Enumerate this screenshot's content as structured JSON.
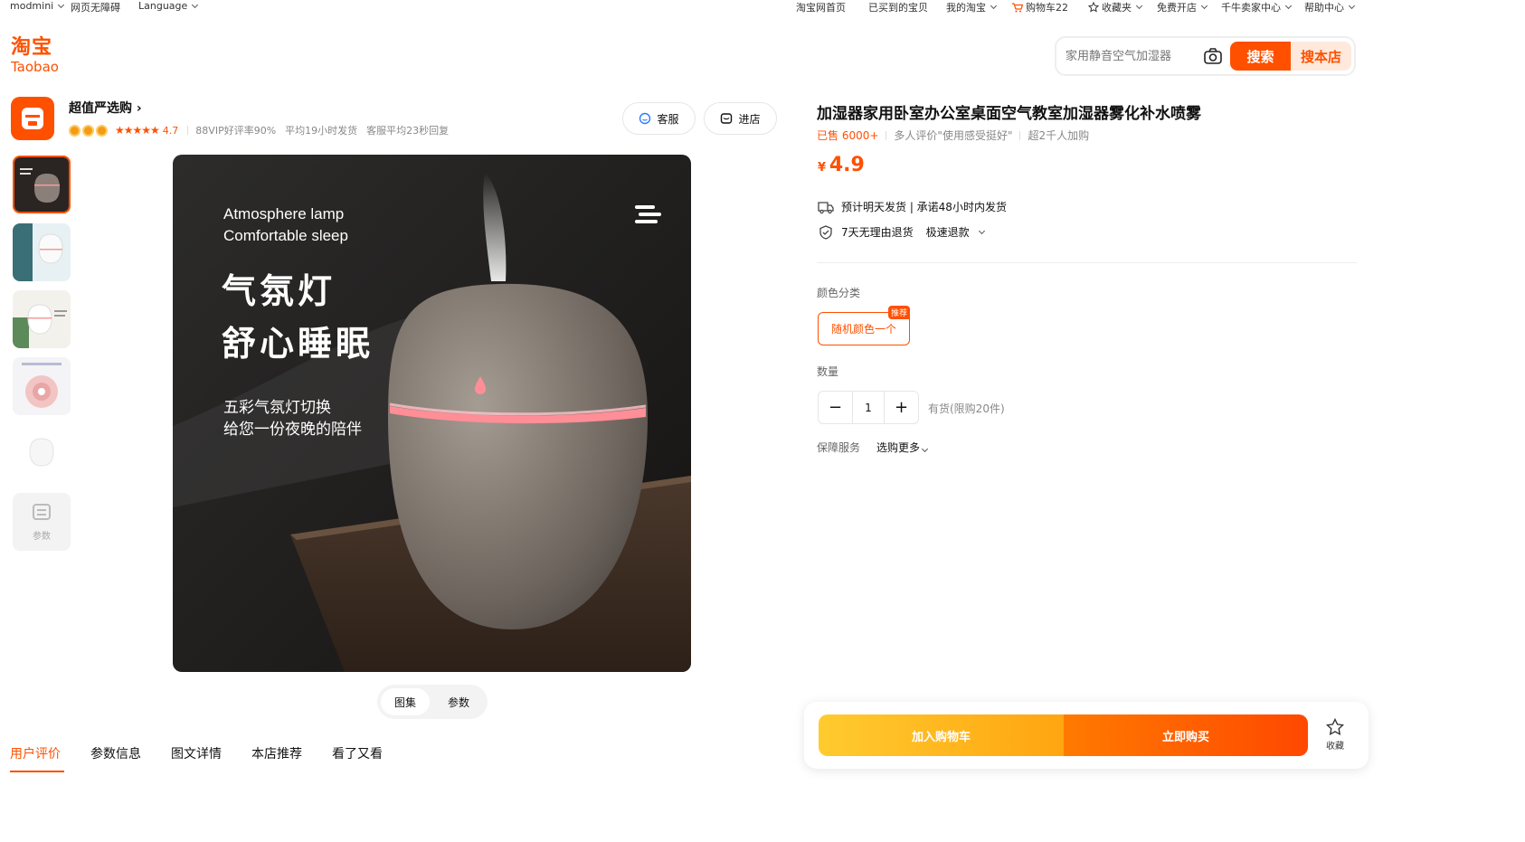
{
  "topbar": {
    "left": [
      "modmini",
      "网页无障碍",
      "Language"
    ],
    "right": [
      "淘宝网首页",
      "已买到的宝贝",
      "我的淘宝",
      "购物车22",
      "收藏夹",
      "免费开店",
      "千牛卖家中心",
      "帮助中心"
    ]
  },
  "logo": {
    "cn": "淘宝",
    "en": "Taobao"
  },
  "search": {
    "placeholder": "家用静音空气加湿器",
    "search_btn": "搜索",
    "store_btn": "搜本店"
  },
  "shop": {
    "name": "超值严选购",
    "rating": "4.7",
    "stars": "★★★★★",
    "stats": [
      "88VIP好评率90%",
      "平均19小时发货",
      "客服平均23秒回复"
    ],
    "service_btn": "客服",
    "enter_btn": "进店"
  },
  "gallery": {
    "param_thumb_label": "参数",
    "image_text_en_1": "Atmosphere lamp",
    "image_text_en_2": "Comfortable sleep",
    "image_text_cn_1": "气氛灯",
    "image_text_cn_2": "舒心睡眠",
    "image_text_sub_1": "五彩气氛灯切换",
    "image_text_sub_2": "给您一份夜晚的陪伴",
    "segment": [
      "图集",
      "参数"
    ]
  },
  "tabs": [
    "用户评价",
    "参数信息",
    "图文详情",
    "本店推荐",
    "看了又看"
  ],
  "product": {
    "title": "加湿器家用卧室办公室桌面空气教室加湿器雾化补水喷雾",
    "sold": "已售 6000+",
    "review": "多人评价\"使用感受挺好\"",
    "cart_count": "超2千人加购",
    "currency": "¥",
    "price": "4.9",
    "shipping": "预计明天发货 | 承诺48小时内发货",
    "returns": "7天无理由退货",
    "refund": "极速退款",
    "color_label": "颜色分类",
    "sku": "随机颜色一个",
    "sku_tag": "推荐",
    "qty_label": "数量",
    "qty": "1",
    "minus": "−",
    "plus": "+",
    "stock": "有货(限购20件)",
    "guarantee_label": "保障服务",
    "more": "选购更多"
  },
  "buybar": {
    "cart": "加入购物车",
    "buy": "立即购买",
    "fav": "收藏"
  },
  "colors": {
    "accent": "#ff5000"
  }
}
